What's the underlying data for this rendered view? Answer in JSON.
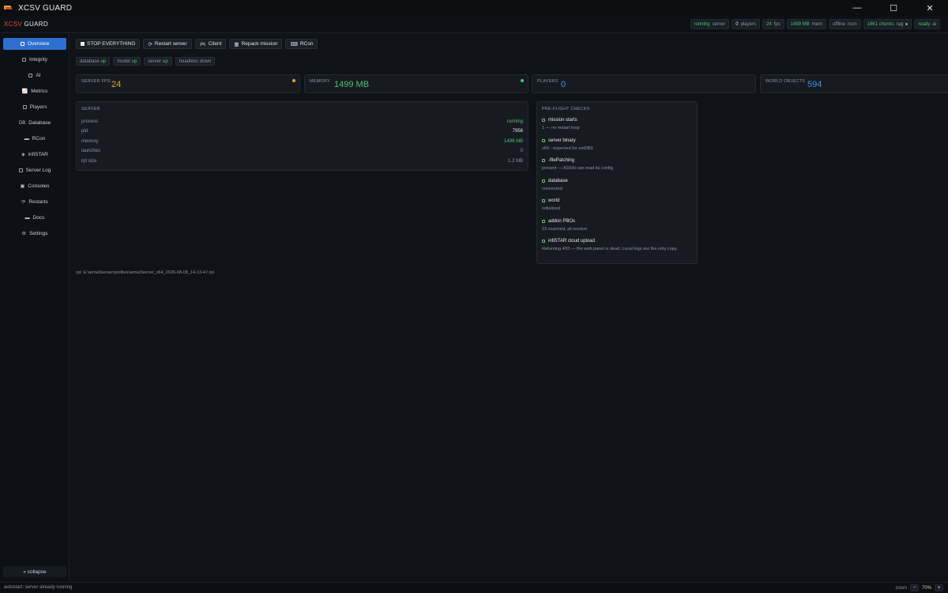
{
  "window": {
    "title": "XCSV GUARD",
    "controls": {
      "minimize": "—",
      "maximize": "☐",
      "close": "✕"
    }
  },
  "brand": {
    "prefix": "XCSV",
    "suffix": "GUARD"
  },
  "status_pills": [
    {
      "value": "running",
      "label": "server"
    },
    {
      "value": "0",
      "label": "players"
    },
    {
      "value": "24",
      "label": "fps"
    },
    {
      "value": "1499 MB",
      "label": "mem"
    },
    {
      "value": "offline",
      "label": "rcon"
    },
    {
      "value": "1861 chunks",
      "label": "rag"
    },
    {
      "value": "ready",
      "label": "ai"
    }
  ],
  "sidebar": {
    "items": [
      {
        "label": "Overview",
        "icon": "square-icon"
      },
      {
        "label": "Integrity",
        "icon": "square-icon"
      },
      {
        "label": "AI",
        "icon": "square-icon"
      },
      {
        "label": "Metrics",
        "icon": "chart-icon"
      },
      {
        "label": "Players",
        "icon": "square-icon"
      },
      {
        "label": "Database",
        "icon": "DB"
      },
      {
        "label": "RCon",
        "icon": "terminal-icon"
      },
      {
        "label": "infiSTAR",
        "icon": "shield-icon"
      },
      {
        "label": "Server Log",
        "icon": "square-icon"
      },
      {
        "label": "Consoles",
        "icon": "console-icon"
      },
      {
        "label": "Restarts",
        "icon": "restart-icon"
      },
      {
        "label": "Docs",
        "icon": "book-icon"
      },
      {
        "label": "Settings",
        "icon": "gear-icon"
      }
    ],
    "collapse_label": "« collapse"
  },
  "toolbar": {
    "stop_all": "STOP EVERYTHING",
    "restart": "Restart server",
    "client": "Client",
    "repack": "Repack mission",
    "rcon": "RCon"
  },
  "chips": [
    {
      "name": "database",
      "state": "up"
    },
    {
      "name": "model",
      "state": "up"
    },
    {
      "name": "server",
      "state": "up"
    },
    {
      "name": "headless",
      "state": "down"
    }
  ],
  "stats": {
    "server_fps": {
      "label": "SERVER FPS",
      "value": "24",
      "color": "#e0a43a",
      "indicator": "#e0a43a"
    },
    "memory": {
      "label": "MEMORY",
      "value": "1499 MB",
      "color": "#4cc46e",
      "indicator": "#4cc46e"
    },
    "players": {
      "label": "PLAYERS",
      "value": "0",
      "color": "#3d8fe0"
    },
    "world_objects": {
      "label": "WORLD OBJECTS",
      "value": "594",
      "color": "#3d8fe0"
    }
  },
  "server_panel": {
    "title": "SERVER",
    "rows": [
      {
        "key": "process",
        "value": "running"
      },
      {
        "key": "pid",
        "value": "7956"
      },
      {
        "key": "memory",
        "value": "1499 MB"
      },
      {
        "key": "launches",
        "value": "0"
      },
      {
        "key": "rpt size",
        "value": "1.2 MB"
      }
    ]
  },
  "preflight": {
    "title": "PRE-FLIGHT CHECKS",
    "checks": [
      {
        "title": "mission starts",
        "detail": "1 — no restart loop"
      },
      {
        "title": "server binary",
        "detail": "x64 - expected for extDB3"
      },
      {
        "title": "-filePatching",
        "detail": "present — A3XAI can read its config"
      },
      {
        "title": "database",
        "detail": "connected"
      },
      {
        "title": "world",
        "detail": "initialized"
      },
      {
        "title": "addon PBOs",
        "detail": "23 scanned, all resolve"
      },
      {
        "title": "infiSTAR cloud upload",
        "detail": "Returning 403 — the web panel is dead. Local logs are the only copy."
      }
    ]
  },
  "rpt_path": "rpt: E:\\arma3server\\profiles\\arma3server_x64_2026-08-08_14-13-47.rpt",
  "statusbar": {
    "message": "autostart: server already running",
    "zoom_label": "zoom",
    "zoom_value": "70%",
    "zoom_minus": "−",
    "zoom_plus": "+"
  }
}
